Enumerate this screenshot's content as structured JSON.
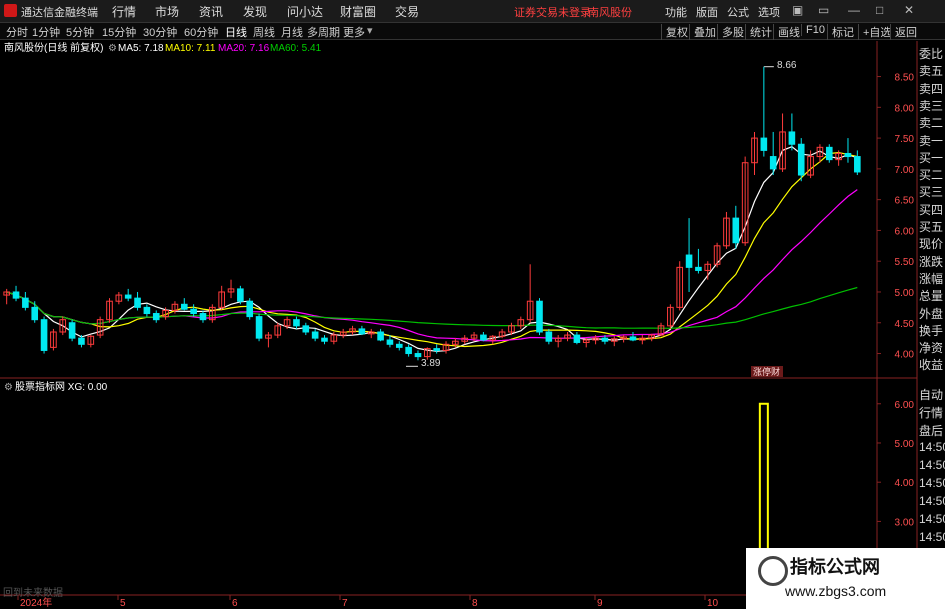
{
  "app": {
    "title": "通达信金融终端"
  },
  "menu": [
    "行情",
    "市场",
    "资讯",
    "发现",
    "问小达",
    "财富圈",
    "交易"
  ],
  "status": {
    "login": "证券交易未登录",
    "stock": "南风股份"
  },
  "right_menu": [
    "功能",
    "版面",
    "公式",
    "选项"
  ],
  "toolbar": {
    "periods": [
      "分时",
      "1分钟",
      "5分钟",
      "15分钟",
      "30分钟",
      "60分钟",
      "日线",
      "周线",
      "月线",
      "多周期",
      "更多"
    ],
    "active": "日线",
    "right": [
      "复权",
      "叠加",
      "多股",
      "统计",
      "画线",
      "F10",
      "标记",
      "+自选",
      "返回"
    ]
  },
  "main_legend": {
    "label": "南风股份(日线 前复权)",
    "ma5": "MA5: 7.18",
    "ma10": "MA10: 7.11",
    "ma20": "MA20: 7.16",
    "ma60": "MA60: 5.41"
  },
  "sub_legend": {
    "label": "股票指标网 XG: 0.00"
  },
  "annotations": {
    "high": "8.66",
    "low": "3.89",
    "tag": "涨停财"
  },
  "side_panel": [
    "委比",
    "卖五",
    "卖四",
    "卖三",
    "卖二",
    "卖一",
    "买一",
    "买二",
    "买三",
    "买四",
    "买五",
    "现价",
    "涨跌",
    "涨幅",
    "总量",
    "外盘",
    "换手",
    "净资",
    "收益"
  ],
  "side_panel2": [
    "自动",
    "行情",
    "盘后",
    "14:50",
    "14:50",
    "14:50",
    "14:50",
    "14:50",
    "14:50"
  ],
  "colors": {
    "up": "#ff3c3c",
    "down": "#00e8f0",
    "ma5": "#ffffff",
    "ma10": "#ffff00",
    "ma20": "#ff00ff",
    "ma60": "#00c000",
    "signal": "#ffff00"
  },
  "watermark": {
    "title": "指标公式网",
    "url": "www.zbgs3.com"
  },
  "bottom_hint": "回到未来数据",
  "chart_data": [
    {
      "type": "candlestick",
      "title": "南风股份(日线 前复权)",
      "x_ticks": [
        "2024年",
        "5",
        "6",
        "7",
        "8",
        "9",
        "10"
      ],
      "y_ticks": [
        4.0,
        4.5,
        5.0,
        5.5,
        6.0,
        6.5,
        7.0,
        7.5,
        8.0,
        8.5
      ],
      "ylim": [
        3.7,
        8.85
      ],
      "candles": [
        [
          4.95,
          5.05,
          4.8,
          5.0
        ],
        [
          5.0,
          5.1,
          4.85,
          4.9
        ],
        [
          4.9,
          5.0,
          4.7,
          4.75
        ],
        [
          4.75,
          4.85,
          4.5,
          4.55
        ],
        [
          4.55,
          4.6,
          4.0,
          4.05
        ],
        [
          4.1,
          4.4,
          4.05,
          4.35
        ],
        [
          4.35,
          4.6,
          4.3,
          4.55
        ],
        [
          4.5,
          4.55,
          4.2,
          4.25
        ],
        [
          4.25,
          4.3,
          4.1,
          4.15
        ],
        [
          4.15,
          4.3,
          4.1,
          4.28
        ],
        [
          4.3,
          4.6,
          4.25,
          4.55
        ],
        [
          4.55,
          4.9,
          4.5,
          4.85
        ],
        [
          4.85,
          5.0,
          4.8,
          4.95
        ],
        [
          4.95,
          5.05,
          4.85,
          4.9
        ],
        [
          4.9,
          5.0,
          4.7,
          4.75
        ],
        [
          4.75,
          4.8,
          4.6,
          4.65
        ],
        [
          4.65,
          4.7,
          4.5,
          4.55
        ],
        [
          4.6,
          4.75,
          4.55,
          4.7
        ],
        [
          4.7,
          4.85,
          4.65,
          4.8
        ],
        [
          4.8,
          4.9,
          4.7,
          4.72
        ],
        [
          4.72,
          4.8,
          4.6,
          4.65
        ],
        [
          4.65,
          4.7,
          4.5,
          4.55
        ],
        [
          4.55,
          4.8,
          4.5,
          4.75
        ],
        [
          4.75,
          5.1,
          4.7,
          5.0
        ],
        [
          5.0,
          5.2,
          4.9,
          5.05
        ],
        [
          5.05,
          5.1,
          4.8,
          4.85
        ],
        [
          4.85,
          4.9,
          4.55,
          4.6
        ],
        [
          4.6,
          4.65,
          4.2,
          4.25
        ],
        [
          4.25,
          4.35,
          4.1,
          4.3
        ],
        [
          4.3,
          4.5,
          4.25,
          4.45
        ],
        [
          4.45,
          4.6,
          4.4,
          4.55
        ],
        [
          4.55,
          4.6,
          4.4,
          4.45
        ],
        [
          4.45,
          4.5,
          4.3,
          4.35
        ],
        [
          4.35,
          4.4,
          4.2,
          4.25
        ],
        [
          4.25,
          4.3,
          4.15,
          4.2
        ],
        [
          4.2,
          4.35,
          4.15,
          4.3
        ],
        [
          4.3,
          4.4,
          4.25,
          4.35
        ],
        [
          4.35,
          4.45,
          4.3,
          4.4
        ],
        [
          4.4,
          4.45,
          4.3,
          4.32
        ],
        [
          4.32,
          4.4,
          4.25,
          4.35
        ],
        [
          4.35,
          4.4,
          4.2,
          4.22
        ],
        [
          4.22,
          4.3,
          4.1,
          4.15
        ],
        [
          4.15,
          4.2,
          4.05,
          4.1
        ],
        [
          4.1,
          4.15,
          3.95,
          4.0
        ],
        [
          4.0,
          4.05,
          3.89,
          3.95
        ],
        [
          3.95,
          4.1,
          3.9,
          4.08
        ],
        [
          4.08,
          4.15,
          4.0,
          4.05
        ],
        [
          4.05,
          4.2,
          4.0,
          4.15
        ],
        [
          4.15,
          4.25,
          4.1,
          4.2
        ],
        [
          4.2,
          4.3,
          4.15,
          4.25
        ],
        [
          4.25,
          4.35,
          4.2,
          4.3
        ],
        [
          4.3,
          4.35,
          4.2,
          4.22
        ],
        [
          4.22,
          4.3,
          4.15,
          4.28
        ],
        [
          4.28,
          4.4,
          4.25,
          4.35
        ],
        [
          4.35,
          4.5,
          4.3,
          4.45
        ],
        [
          4.45,
          4.6,
          4.4,
          4.55
        ],
        [
          4.55,
          5.45,
          4.5,
          4.85
        ],
        [
          4.85,
          4.9,
          4.3,
          4.35
        ],
        [
          4.35,
          4.4,
          4.15,
          4.2
        ],
        [
          4.2,
          4.3,
          4.1,
          4.25
        ],
        [
          4.25,
          4.35,
          4.2,
          4.3
        ],
        [
          4.3,
          4.35,
          4.15,
          4.18
        ],
        [
          4.18,
          4.25,
          4.1,
          4.22
        ],
        [
          4.22,
          4.3,
          4.15,
          4.25
        ],
        [
          4.25,
          4.3,
          4.15,
          4.2
        ],
        [
          4.2,
          4.28,
          4.12,
          4.24
        ],
        [
          4.24,
          4.3,
          4.18,
          4.27
        ],
        [
          4.27,
          4.35,
          4.2,
          4.22
        ],
        [
          4.22,
          4.3,
          4.15,
          4.25
        ],
        [
          4.25,
          4.32,
          4.2,
          4.3
        ],
        [
          4.3,
          4.5,
          4.28,
          4.45
        ],
        [
          4.45,
          4.8,
          4.4,
          4.75
        ],
        [
          4.75,
          5.5,
          4.7,
          5.4
        ],
        [
          5.6,
          6.2,
          5.0,
          5.4
        ],
        [
          5.4,
          5.7,
          5.3,
          5.35
        ],
        [
          5.35,
          5.5,
          5.2,
          5.45
        ],
        [
          5.45,
          5.8,
          5.4,
          5.75
        ],
        [
          5.75,
          6.3,
          5.7,
          6.2
        ],
        [
          6.2,
          6.4,
          5.7,
          5.8
        ],
        [
          5.8,
          7.2,
          5.75,
          7.1
        ],
        [
          7.1,
          7.6,
          6.9,
          7.5
        ],
        [
          7.5,
          8.66,
          7.2,
          7.3
        ],
        [
          7.2,
          7.6,
          6.9,
          7.0
        ],
        [
          7.0,
          7.9,
          6.95,
          7.6
        ],
        [
          7.6,
          7.9,
          7.3,
          7.4
        ],
        [
          7.4,
          7.5,
          6.8,
          6.9
        ],
        [
          6.9,
          7.3,
          6.85,
          7.2
        ],
        [
          7.2,
          7.4,
          7.1,
          7.35
        ],
        [
          7.35,
          7.4,
          7.1,
          7.15
        ],
        [
          7.15,
          7.3,
          7.05,
          7.25
        ],
        [
          7.25,
          7.5,
          7.1,
          7.2
        ],
        [
          7.2,
          7.3,
          6.9,
          6.95
        ]
      ],
      "ma_lines": [
        "MA5",
        "MA10",
        "MA20",
        "MA60"
      ]
    },
    {
      "type": "bar",
      "title": "股票指标网 XG",
      "y_ticks": [
        2.0,
        3.0,
        4.0,
        5.0,
        6.0
      ],
      "ylim": [
        1.2,
        6.3
      ],
      "signal_index": 81,
      "signal_value": 6.0
    }
  ]
}
